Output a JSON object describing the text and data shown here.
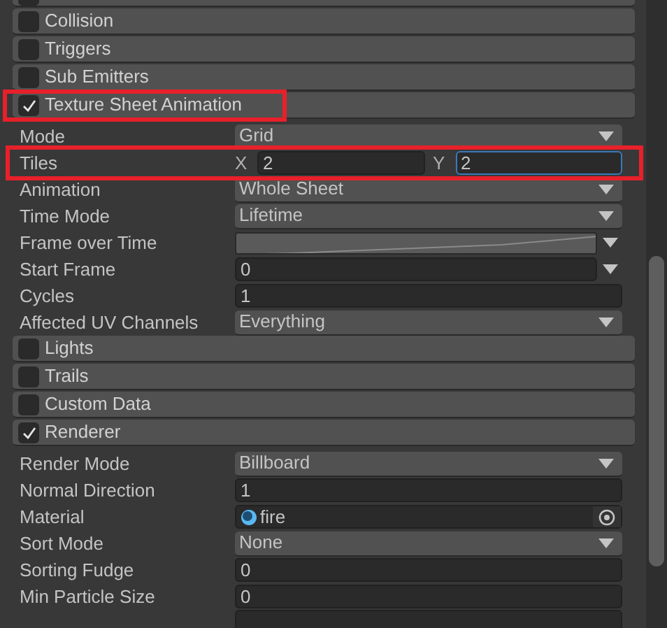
{
  "rows": [
    {
      "kind": "module",
      "enabled": false
    },
    {
      "kind": "module",
      "label": "Collision",
      "enabled": false
    },
    {
      "kind": "module",
      "label": "Triggers",
      "enabled": false
    },
    {
      "kind": "module",
      "label": "Sub Emitters",
      "enabled": false
    },
    {
      "kind": "module",
      "label": "Texture Sheet Animation",
      "enabled": true,
      "highlighted": true
    },
    {
      "kind": "dropdown",
      "label": "Mode",
      "value": "Grid"
    },
    {
      "kind": "tiles",
      "label": "Tiles",
      "highlighted": true,
      "fields": [
        {
          "axis": "X",
          "value": "2",
          "focused": false
        },
        {
          "axis": "Y",
          "value": "2",
          "focused": true
        }
      ]
    },
    {
      "kind": "dropdown",
      "label": "Animation",
      "value": "Whole Sheet"
    },
    {
      "kind": "dropdown",
      "label": "Time Mode",
      "value": "Lifetime"
    },
    {
      "kind": "curve",
      "label": "Frame over Time"
    },
    {
      "kind": "number_dropdown",
      "label": "Start Frame",
      "value": "0"
    },
    {
      "kind": "number",
      "label": "Cycles",
      "value": "1"
    },
    {
      "kind": "dropdown",
      "label": "Affected UV Channels",
      "value": "Everything"
    },
    {
      "kind": "module",
      "label": "Lights",
      "enabled": false
    },
    {
      "kind": "module",
      "label": "Trails",
      "enabled": false
    },
    {
      "kind": "module",
      "label": "Custom Data",
      "enabled": false
    },
    {
      "kind": "module",
      "label": "Renderer",
      "enabled": true
    },
    {
      "kind": "dropdown",
      "label": "Render Mode",
      "value": "Billboard"
    },
    {
      "kind": "number",
      "label": "Normal Direction",
      "value": "1"
    },
    {
      "kind": "object",
      "label": "Material",
      "value": "fire"
    },
    {
      "kind": "dropdown",
      "label": "Sort Mode",
      "value": "None"
    },
    {
      "kind": "number",
      "label": "Sorting Fudge",
      "value": "0"
    },
    {
      "kind": "number",
      "label": "Min Particle Size",
      "value": "0"
    },
    {
      "kind": "number"
    }
  ]
}
